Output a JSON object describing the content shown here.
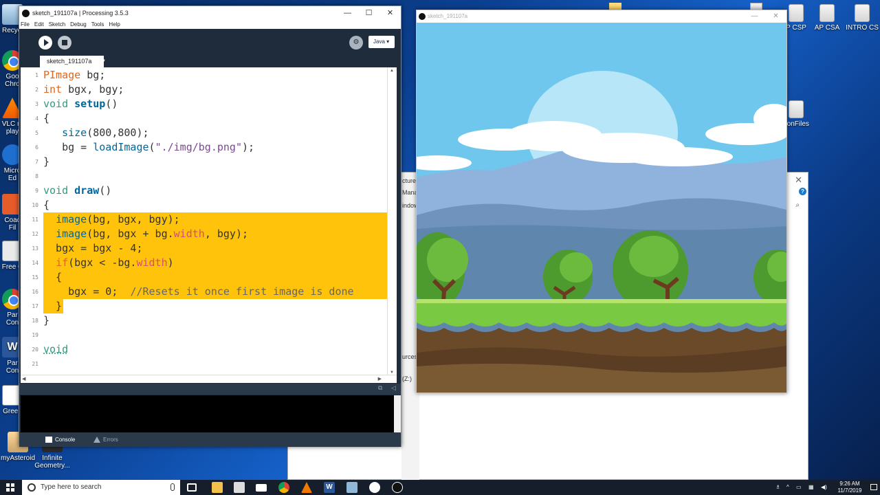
{
  "desktop": {
    "icons_left": [
      {
        "label": "Recycl",
        "icon": "recycle-bin-icon"
      },
      {
        "label": "Goo\nChro",
        "icon": "chrome-icon"
      },
      {
        "label": "VLC m\nplay",
        "icon": "vlc-icon"
      },
      {
        "label": "Micro\nEd",
        "icon": "edge-icon"
      },
      {
        "label": "Coac\nFil",
        "icon": "coach-icon"
      },
      {
        "label": "Free C",
        "icon": "file-icon"
      },
      {
        "label": "Par\nCon",
        "icon": "chrome-icon"
      },
      {
        "label": "Par\nCon",
        "icon": "word-icon"
      },
      {
        "label": "Green",
        "icon": "greenfoot-icon"
      },
      {
        "label": "myAsteroid",
        "icon": "asteroid-icon"
      },
      {
        "label": "Infinite\nGeometry...",
        "icon": "game-icon"
      }
    ],
    "icons_right": [
      {
        "label": "P CSP",
        "icon": "document-icon"
      },
      {
        "label": "AP CSA",
        "icon": "document-icon"
      },
      {
        "label": "INTRO CS",
        "icon": "document-icon"
      },
      {
        "label": "honFiles",
        "icon": "document-icon"
      }
    ]
  },
  "explorer_fragments": [
    "cture T",
    "Mana",
    "indow",
    "urces)",
    "(Z:)"
  ],
  "ide": {
    "window_title": "sketch_191107a | Processing 3.5.3",
    "menu": [
      "File",
      "Edit",
      "Sketch",
      "Debug",
      "Tools",
      "Help"
    ],
    "mode": "Java ▾",
    "tab_name": "sketch_191107a",
    "code": [
      {
        "n": "1",
        "text": "PImage bg;"
      },
      {
        "n": "2",
        "text": "int bgx, bgy;"
      },
      {
        "n": "3",
        "text": "void setup()"
      },
      {
        "n": "4",
        "text": "{"
      },
      {
        "n": "5",
        "text": "   size(800,800);"
      },
      {
        "n": "6",
        "text": "   bg = loadImage(\"./img/bg.png\");"
      },
      {
        "n": "7",
        "text": "}"
      },
      {
        "n": "8",
        "text": ""
      },
      {
        "n": "9",
        "text": "void draw()"
      },
      {
        "n": "10",
        "text": "{"
      },
      {
        "n": "11",
        "text": "  image(bg, bgx, bgy);"
      },
      {
        "n": "12",
        "text": "  image(bg, bgx + bg.width, bgy);"
      },
      {
        "n": "13",
        "text": "  bgx = bgx - 4;"
      },
      {
        "n": "14",
        "text": "  if(bgx < -bg.width)"
      },
      {
        "n": "15",
        "text": "  {"
      },
      {
        "n": "16",
        "text": "    bgx = 0;  //Resets it once first image is done"
      },
      {
        "n": "17",
        "text": "  }"
      },
      {
        "n": "18",
        "text": "}"
      },
      {
        "n": "19",
        "text": ""
      },
      {
        "n": "20",
        "text": "void"
      },
      {
        "n": "21",
        "text": ""
      }
    ],
    "console_tab": "Console",
    "errors_tab": "Errors"
  },
  "sketch_window": {
    "title": "sketch_191107a"
  },
  "taskbar": {
    "search_placeholder": "Type here to search",
    "time": "9:26 AM",
    "date": "11/7/2019"
  }
}
